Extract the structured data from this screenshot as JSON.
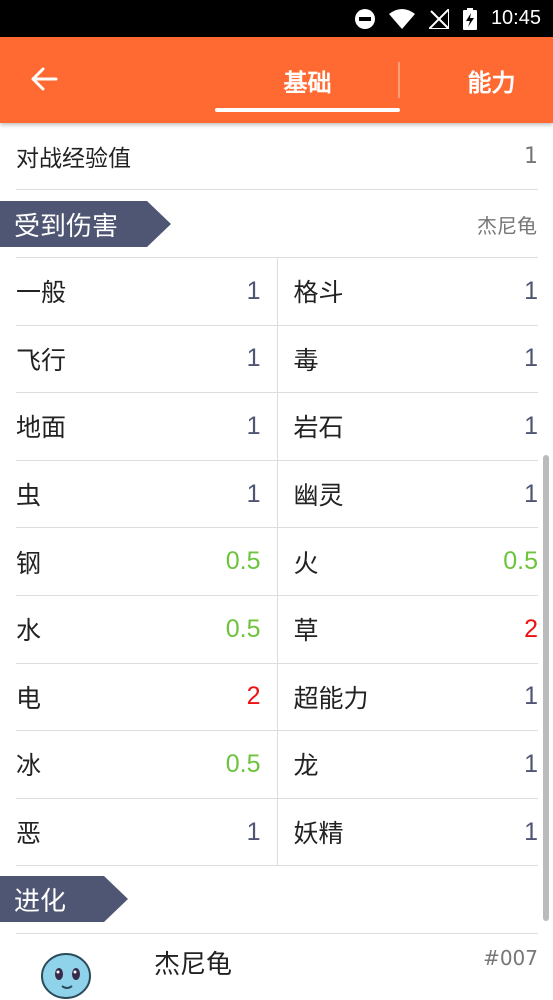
{
  "status_bar": {
    "time": "10:45"
  },
  "toolbar": {
    "tabs": [
      {
        "label": "基础"
      },
      {
        "label": "能力"
      }
    ]
  },
  "stats": {
    "battle_exp_label": "对战经验值",
    "battle_exp_value": "1"
  },
  "damage": {
    "title": "受到伤害",
    "pokemon": "杰尼龟",
    "rows": [
      [
        {
          "type": "一般",
          "mult": "1"
        },
        {
          "type": "格斗",
          "mult": "1"
        }
      ],
      [
        {
          "type": "飞行",
          "mult": "1"
        },
        {
          "type": "毒",
          "mult": "1"
        }
      ],
      [
        {
          "type": "地面",
          "mult": "1"
        },
        {
          "type": "岩石",
          "mult": "1"
        }
      ],
      [
        {
          "type": "虫",
          "mult": "1"
        },
        {
          "type": "幽灵",
          "mult": "1"
        }
      ],
      [
        {
          "type": "钢",
          "mult": "0.5"
        },
        {
          "type": "火",
          "mult": "0.5"
        }
      ],
      [
        {
          "type": "水",
          "mult": "0.5"
        },
        {
          "type": "草",
          "mult": "2"
        }
      ],
      [
        {
          "type": "电",
          "mult": "2"
        },
        {
          "type": "超能力",
          "mult": "1"
        }
      ],
      [
        {
          "type": "冰",
          "mult": "0.5"
        },
        {
          "type": "龙",
          "mult": "1"
        }
      ],
      [
        {
          "type": "恶",
          "mult": "1"
        },
        {
          "type": "妖精",
          "mult": "1"
        }
      ]
    ]
  },
  "evolution": {
    "title": "进化",
    "entries": [
      {
        "name": "杰尼龟",
        "number": "#007"
      }
    ]
  },
  "colors": {
    "accent": "#ff6a33",
    "section_tag": "#4f5673",
    "normal": "#4f5673",
    "resist": "#6cc33c",
    "weak": "#ee1111"
  }
}
